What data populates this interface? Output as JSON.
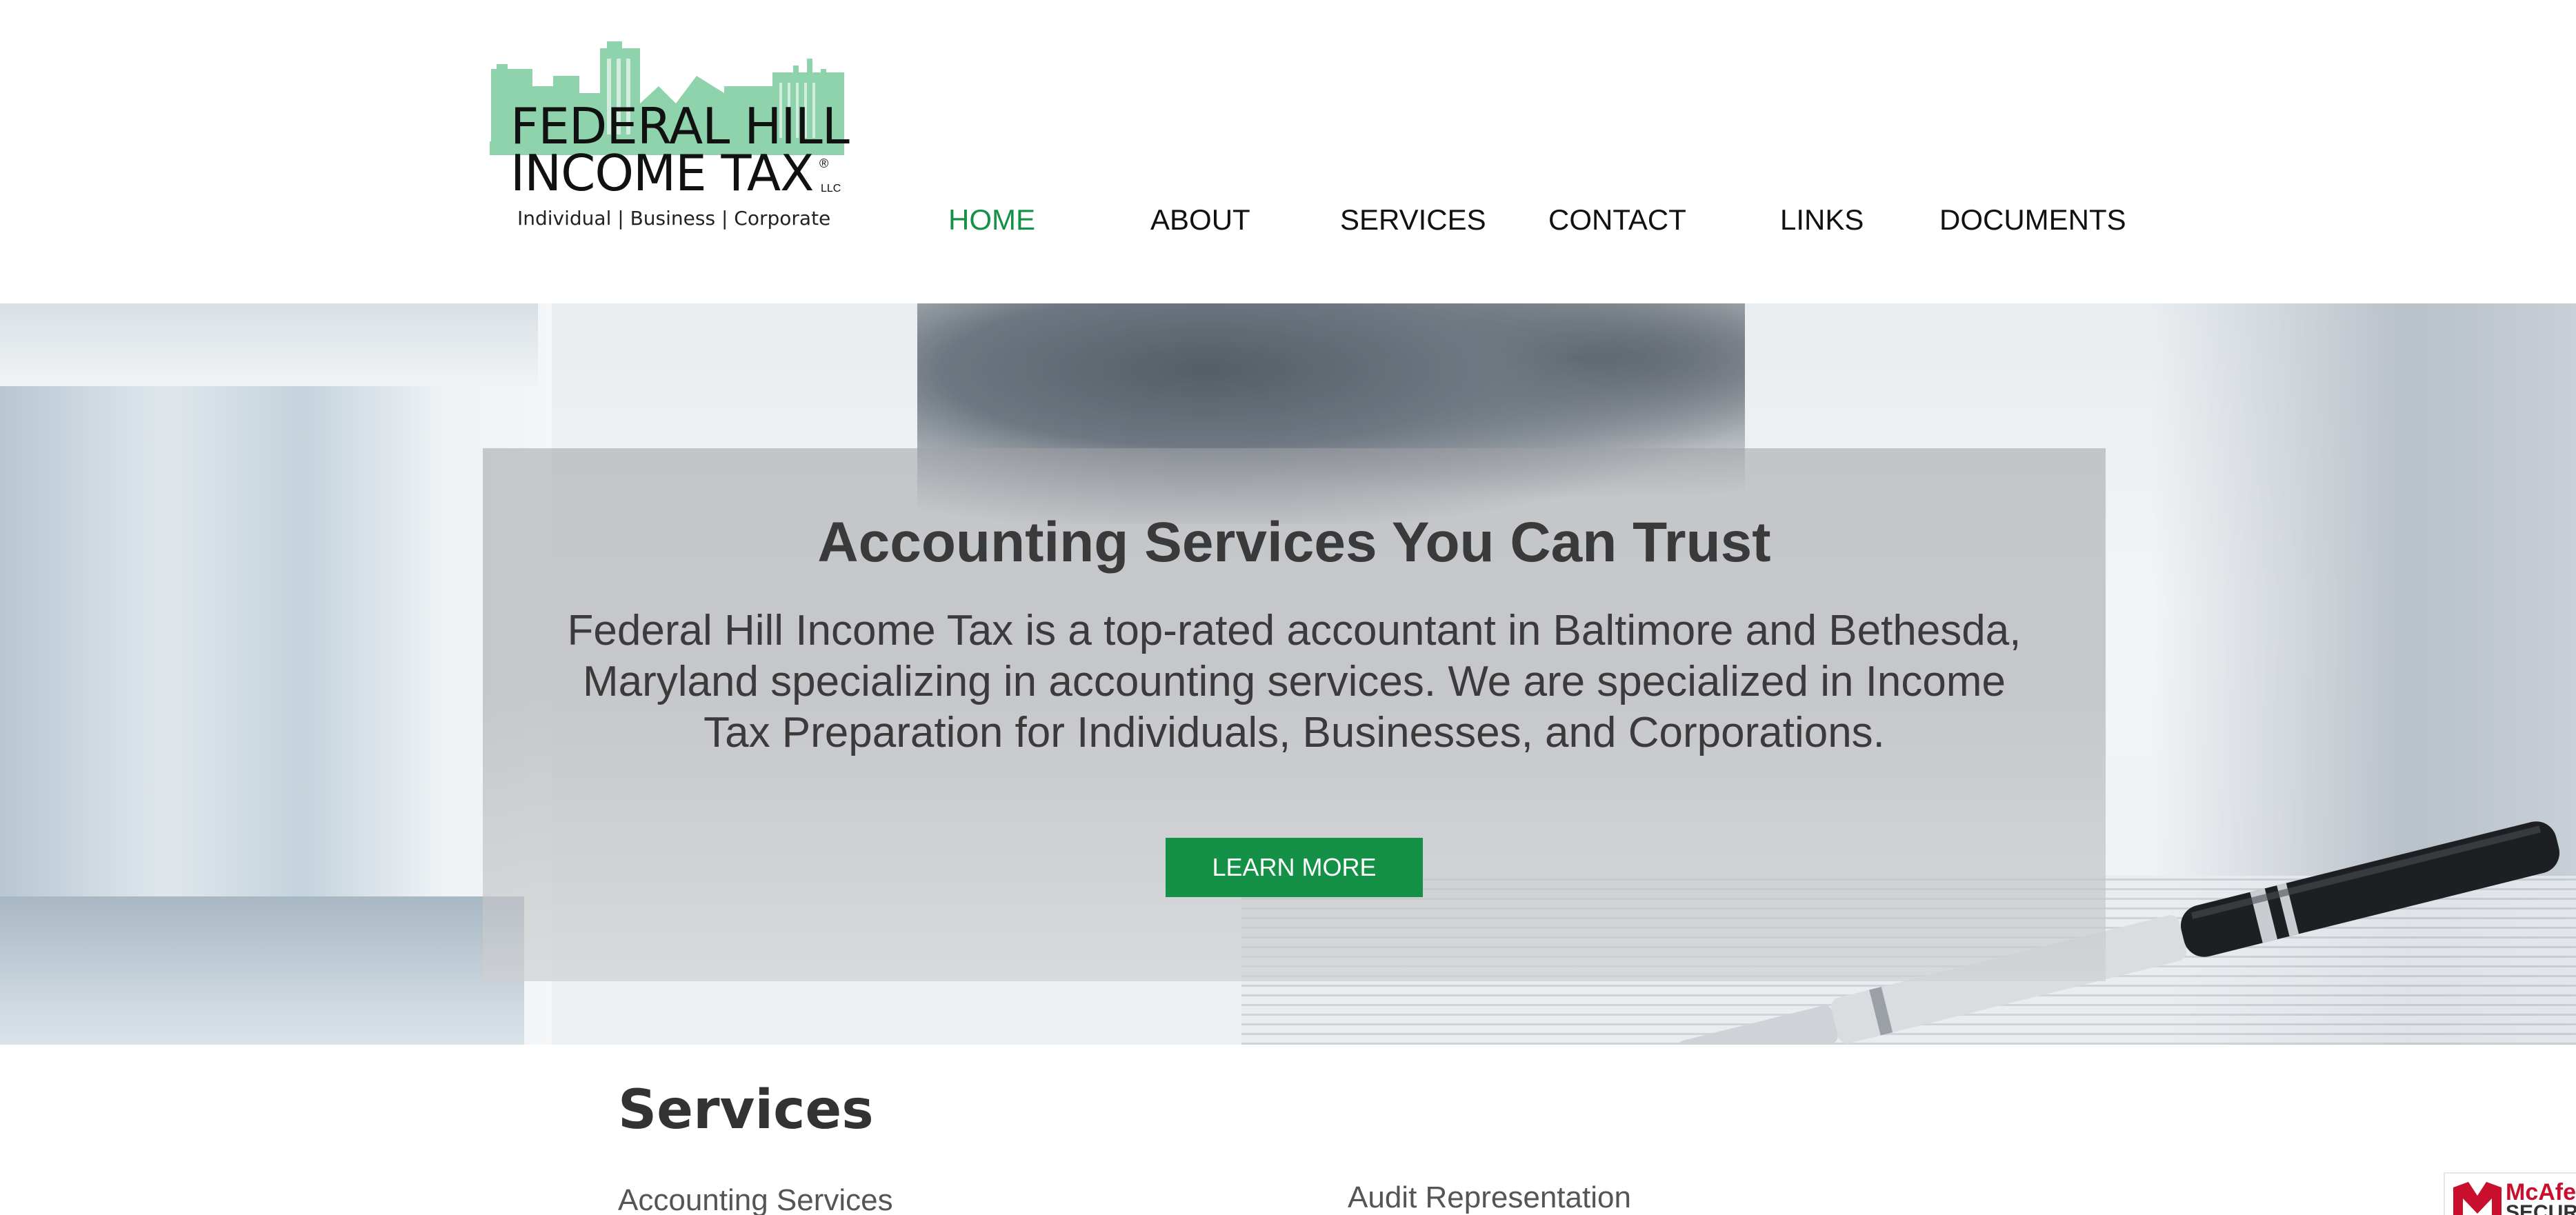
{
  "logo": {
    "line1": "FEDERAL HILL",
    "line2": "INCOME TAX",
    "registered": "®",
    "suffix": "LLC",
    "tagline": "Individual  |  Business  |  Corporate",
    "accent_color": "#8fd3ad"
  },
  "nav": {
    "items": [
      {
        "label": "HOME",
        "active": true
      },
      {
        "label": "ABOUT",
        "active": false
      },
      {
        "label": "SERVICES",
        "active": false
      },
      {
        "label": "CONTACT",
        "active": false
      },
      {
        "label": "LINKS",
        "active": false
      },
      {
        "label": "DOCUMENTS",
        "active": false
      }
    ],
    "active_color": "#149146"
  },
  "hero": {
    "title": "Accounting Services You Can Trust",
    "description": "Federal Hill Income Tax is a top-rated accountant in Baltimore and Bethesda, Maryland specializing in accounting services. We are specialized in Income Tax Preparation for Individuals, Businesses, and Corporations.",
    "button_label": "LEARN MORE",
    "button_color": "#149146"
  },
  "services": {
    "title": "Services",
    "items": [
      "Accounting Services",
      "Audit Representation"
    ]
  },
  "badge": {
    "brand": "McAfee",
    "sub": "SECURE",
    "icon": "mcafee-shield-icon"
  }
}
